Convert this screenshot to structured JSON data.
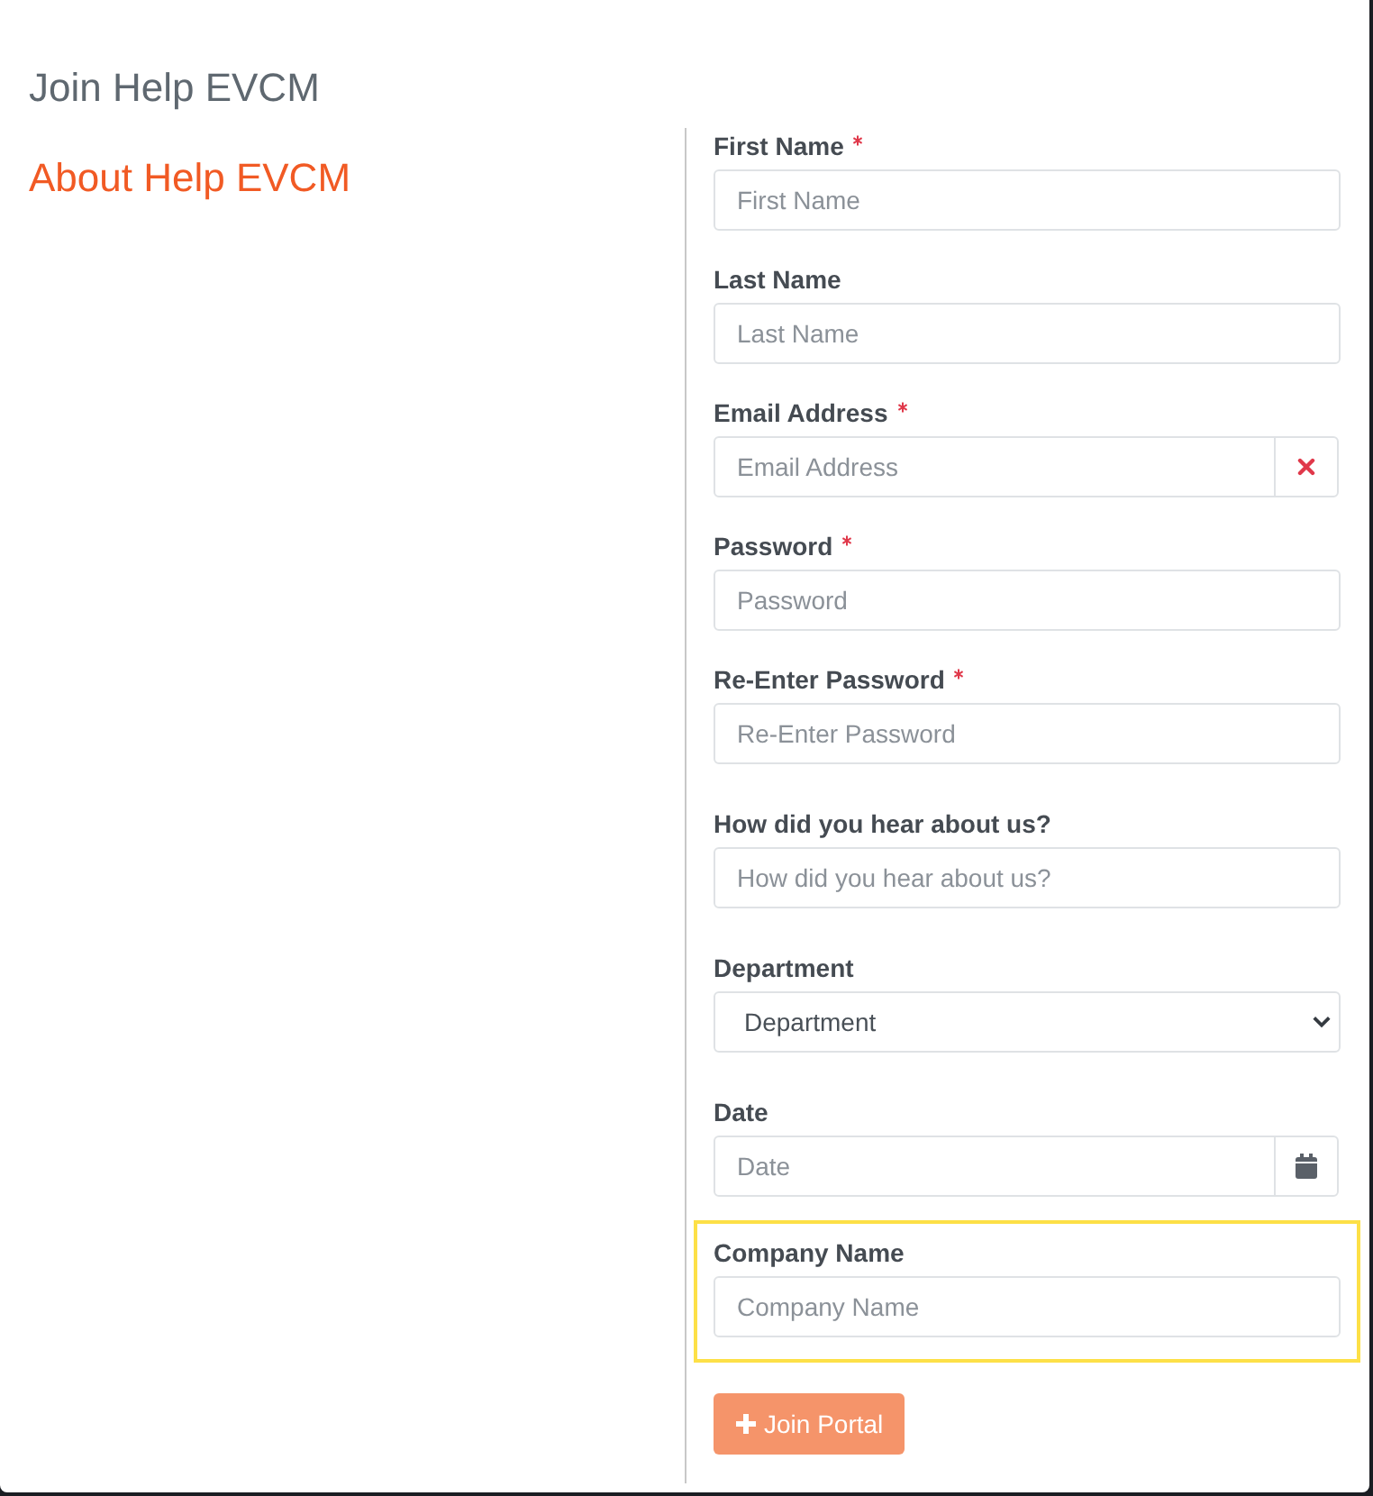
{
  "title": "Join Help EVCM",
  "about_heading": "About Help EVCM",
  "fields": [
    {
      "kind": "text",
      "label": "First Name",
      "required": true,
      "placeholder": "First Name",
      "highlighted": false
    },
    {
      "kind": "text",
      "label": "Last Name",
      "required": false,
      "placeholder": "Last Name",
      "highlighted": false
    },
    {
      "kind": "clearable",
      "label": "Email Address",
      "required": true,
      "placeholder": "Email Address",
      "highlighted": false
    },
    {
      "kind": "text",
      "label": "Password",
      "required": true,
      "placeholder": "Password",
      "highlighted": false
    },
    {
      "kind": "text",
      "label": "Re-Enter Password",
      "required": true,
      "placeholder": "Re-Enter Password",
      "highlighted": false
    },
    {
      "kind": "text",
      "label": "How did you hear about us?",
      "required": false,
      "placeholder": "How did you hear about us?",
      "highlighted": false
    },
    {
      "kind": "select",
      "label": "Department",
      "required": false,
      "value": "Department",
      "highlighted": false
    },
    {
      "kind": "date",
      "label": "Date",
      "required": false,
      "placeholder": "Date",
      "highlighted": false
    },
    {
      "kind": "text",
      "label": "Company Name",
      "required": false,
      "placeholder": "Company Name",
      "highlighted": true
    }
  ],
  "submit_button": "Join Portal"
}
